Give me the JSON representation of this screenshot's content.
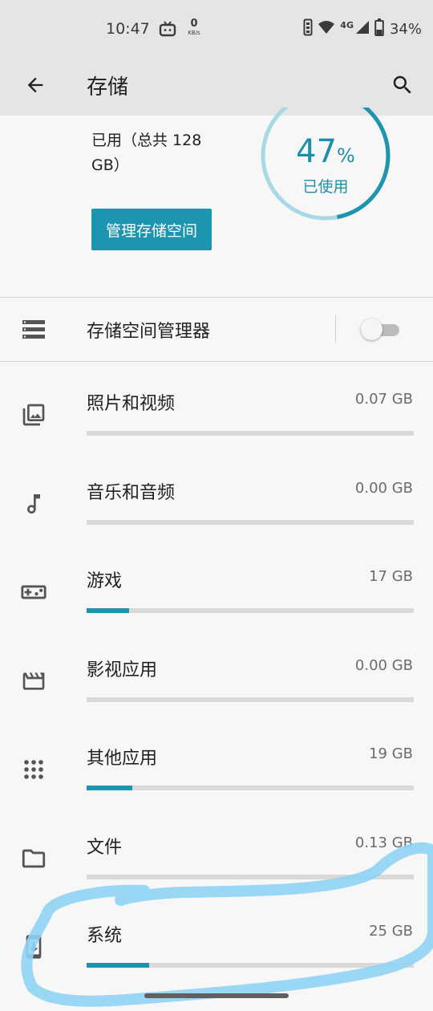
{
  "status_bar": {
    "time": "10:47",
    "net_speed_value": "0",
    "net_speed_unit": "KB/s",
    "network_type": "4G",
    "battery": "34%",
    "icons": [
      "tv-icon",
      "vibrate-icon",
      "wifi-icon",
      "signal-icon",
      "battery-icon"
    ]
  },
  "app_bar": {
    "title": "存储",
    "back_icon": "arrow-back-icon",
    "search_icon": "search-icon"
  },
  "summary": {
    "used_text": "已用（总共 128 GB）",
    "percent_value": "47",
    "percent_sign": "%",
    "percent": 47,
    "percent_label": "已使用",
    "manage_button": "管理存储空间"
  },
  "storage_manager": {
    "label": "存储空间管理器",
    "icon": "storage-list-icon",
    "enabled": false
  },
  "categories": [
    {
      "label": "照片和视频",
      "size": "0.07 GB",
      "usage_fraction": 0.0,
      "icon": "photo-library-icon"
    },
    {
      "label": "音乐和音频",
      "size": "0.00 GB",
      "usage_fraction": 0.0,
      "icon": "music-note-icon"
    },
    {
      "label": "游戏",
      "size": "17 GB",
      "usage_fraction": 0.13,
      "icon": "gamepad-icon"
    },
    {
      "label": "影视应用",
      "size": "0.00 GB",
      "usage_fraction": 0.0,
      "icon": "movie-clapper-icon"
    },
    {
      "label": "其他应用",
      "size": "19 GB",
      "usage_fraction": 0.14,
      "icon": "apps-grid-icon"
    },
    {
      "label": "文件",
      "size": "0.13 GB",
      "usage_fraction": 0.0,
      "icon": "folder-icon"
    },
    {
      "label": "系统",
      "size": "25 GB",
      "usage_fraction": 0.19,
      "icon": "system-update-icon"
    }
  ],
  "colors": {
    "accent": "#1d95ae",
    "accent_text": "#1d8fa6",
    "track": "#d9d9d9",
    "donut_light": "#a7d8e3",
    "highlight_scribble": "#8fd3f4",
    "app_bar_bg": "#e5e5e5",
    "page_bg": "#f7f7f7"
  }
}
